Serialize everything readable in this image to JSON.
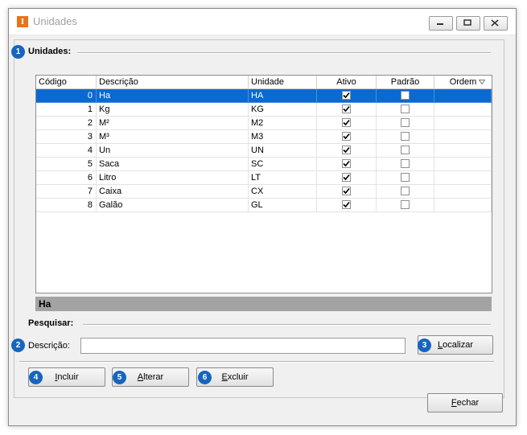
{
  "window": {
    "title": "Unidades",
    "icon_letter": "I",
    "accent_color": "#e8731a"
  },
  "sections": {
    "units_badge": "1",
    "units_label": "Unidades:",
    "search_label": "Pesquisar:"
  },
  "grid": {
    "columns": [
      "Código",
      "Descrição",
      "Unidade",
      "Ativo",
      "Padrão",
      "Ordem"
    ],
    "rows": [
      {
        "codigo": "0",
        "descricao": "Ha",
        "unidade": "HA",
        "ativo": true,
        "padrao": false
      },
      {
        "codigo": "1",
        "descricao": "Kg",
        "unidade": "KG",
        "ativo": true,
        "padrao": false
      },
      {
        "codigo": "2",
        "descricao": "M²",
        "unidade": "M2",
        "ativo": true,
        "padrao": false
      },
      {
        "codigo": "3",
        "descricao": "M³",
        "unidade": "M3",
        "ativo": true,
        "padrao": false
      },
      {
        "codigo": "4",
        "descricao": "Un",
        "unidade": "UN",
        "ativo": true,
        "padrao": false
      },
      {
        "codigo": "5",
        "descricao": "Saca",
        "unidade": "SC",
        "ativo": true,
        "padrao": false
      },
      {
        "codigo": "6",
        "descricao": "Litro",
        "unidade": "LT",
        "ativo": true,
        "padrao": false
      },
      {
        "codigo": "7",
        "descricao": "Caixa",
        "unidade": "CX",
        "ativo": true,
        "padrao": false
      },
      {
        "codigo": "8",
        "descricao": "Galão",
        "unidade": "GL",
        "ativo": true,
        "padrao": false
      }
    ],
    "selected_index": 0,
    "selection_color": "#0a6ad1"
  },
  "detail": {
    "value": "Ha"
  },
  "search": {
    "badge": "2",
    "label": "Descrição:",
    "value": "",
    "placeholder": ""
  },
  "buttons": {
    "localizar": {
      "badge": "3",
      "mnemonic": "L",
      "rest": "ocalizar"
    },
    "incluir": {
      "badge": "4",
      "mnemonic": "I",
      "rest": "ncluir"
    },
    "alterar": {
      "badge": "5",
      "mnemonic": "A",
      "rest": "lterar"
    },
    "excluir": {
      "badge": "6",
      "mnemonic": "E",
      "rest": "xcluir"
    },
    "fechar": {
      "mnemonic": "F",
      "rest": "echar"
    }
  },
  "badge_color": "#1565c0"
}
